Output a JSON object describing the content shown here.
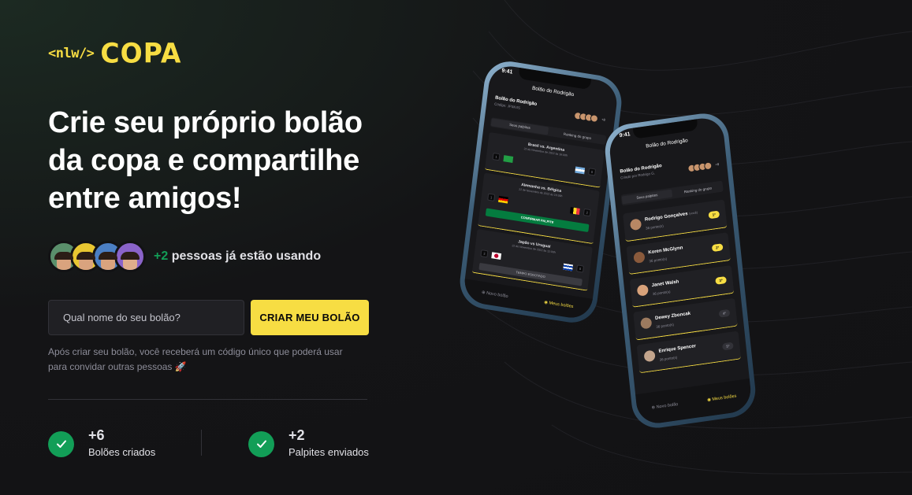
{
  "logo": {
    "nlw": "<nlw/>",
    "copa": "COPA"
  },
  "headline": "Crie seu próprio bolão da copa e compartilhe entre amigos!",
  "users": {
    "plus": "+2",
    "text": " pessoas já estão usando"
  },
  "form": {
    "placeholder": "Qual nome do seu bolão?",
    "button": "CRIAR MEU BOLÃO"
  },
  "hint": "Após criar seu bolão, você receberá um código único que poderá usar para convidar outras pessoas 🚀",
  "stats": [
    {
      "value": "+6",
      "label": "Bolões criados"
    },
    {
      "value": "+2",
      "label": "Palpites enviados"
    }
  ],
  "colors": {
    "accent": "#f7dd43",
    "success": "#129e57",
    "background": "#121214"
  },
  "phone_back": {
    "time": "9:41",
    "header": "Bolão do Rodrigão",
    "group": "Bolão do Rodrigão",
    "code": "Código: JP3K4S",
    "count": "+8",
    "tabs": [
      "Seus palpites",
      "Ranking do grupo"
    ],
    "matches": [
      {
        "title": "Brasil vs. Argentina",
        "date": "22 de Novembro de 2022 às 16:00h",
        "left": "1",
        "right": "0"
      },
      {
        "title": "Alemanha vs. Bélgica",
        "date": "22 de Novembro de 2022 às 16:00h",
        "left": "1",
        "right": "2"
      },
      {
        "title": "Japão vs Uruguai",
        "date": "22 de Novembro de 2022 às 12:00h",
        "left": "3",
        "right": "0"
      }
    ],
    "confirm": "CONFIRMAR PALPITE",
    "expired": "TEMPO ESGOTADO",
    "nav": [
      "Novo bolão",
      "Meus bolões"
    ]
  },
  "phone_front": {
    "time": "9:41",
    "header": "Bolão do Rodrigão",
    "group": "Bolão do Rodrigão",
    "creator": "Criado por Rodrigo G.",
    "count": "+8",
    "tabs": [
      "Seus palpites",
      "Ranking do grupo"
    ],
    "ranking": [
      {
        "name": "Rodrigo Gonçalves",
        "you": "(você)",
        "pts": "36 ponto(s)",
        "pos": "1º"
      },
      {
        "name": "Koren McGlynn",
        "pts": "36 ponto(s)",
        "pos": "2º"
      },
      {
        "name": "Janet Walsh",
        "pts": "36 ponto(s)",
        "pos": "3º"
      },
      {
        "name": "Dewey Zboncak",
        "pts": "36 ponto(s)",
        "pos": "4º"
      },
      {
        "name": "Enrique Spencer",
        "pts": "36 ponto(s)",
        "pos": "5º"
      }
    ],
    "nav": [
      "Novo bolão",
      "Meus bolões"
    ]
  }
}
